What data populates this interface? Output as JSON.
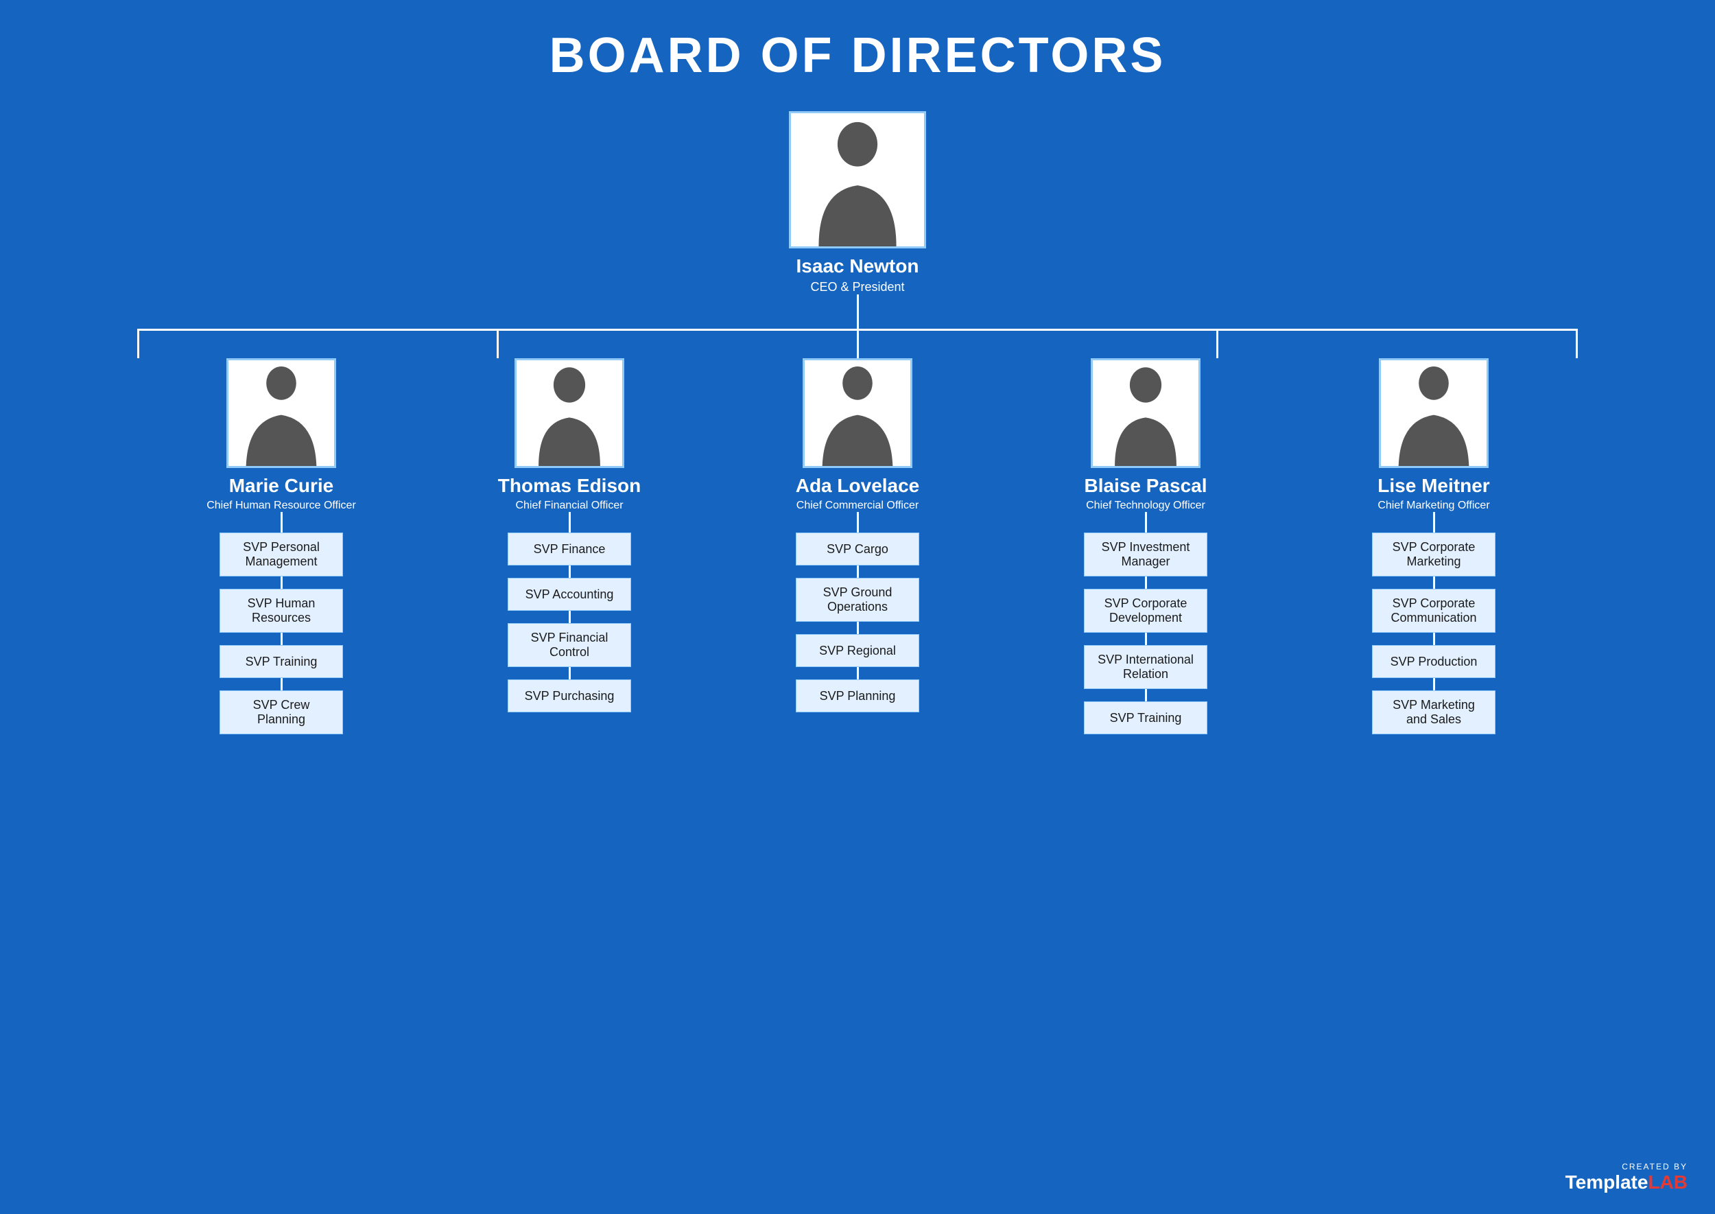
{
  "title": "BOARD OF DIRECTORS",
  "brand": {
    "created_by": "CREATED BY",
    "name": "TemplateLAB",
    "name_highlight": "LAB"
  },
  "ceo": {
    "name": "Isaac Newton",
    "title": "CEO & President",
    "gender": "male"
  },
  "executives": [
    {
      "name": "Marie Curie",
      "title": "Chief Human Resource Officer",
      "gender": "female",
      "svp": [
        "SVP Personal Management",
        "SVP Human Resources",
        "SVP Training",
        "SVP Crew Planning"
      ]
    },
    {
      "name": "Thomas Edison",
      "title": "Chief Financial Officer",
      "gender": "male",
      "svp": [
        "SVP Finance",
        "SVP Accounting",
        "SVP Financial Control",
        "SVP Purchasing"
      ]
    },
    {
      "name": "Ada Lovelace",
      "title": "Chief Commercial Officer",
      "gender": "female",
      "svp": [
        "SVP Cargo",
        "SVP Ground Operations",
        "SVP Regional",
        "SVP Planning"
      ]
    },
    {
      "name": "Blaise Pascal",
      "title": "Chief Technology Officer",
      "gender": "male",
      "svp": [
        "SVP Investment Manager",
        "SVP Corporate Development",
        "SVP International Relation",
        "SVP Training"
      ]
    },
    {
      "name": "Lise Meitner",
      "title": "Chief Marketing Officer",
      "gender": "female",
      "svp": [
        "SVP Corporate Marketing",
        "SVP Corporate Communication",
        "SVP Production",
        "SVP Marketing and Sales"
      ]
    }
  ],
  "colors": {
    "background": "#1565C0",
    "card_bg": "#FFFFFF",
    "card_border": "#90CAF9",
    "svp_bg": "#E3F0FF",
    "connector": "#FFFFFF",
    "text_white": "#FFFFFF",
    "text_dark": "#1a1a1a"
  }
}
